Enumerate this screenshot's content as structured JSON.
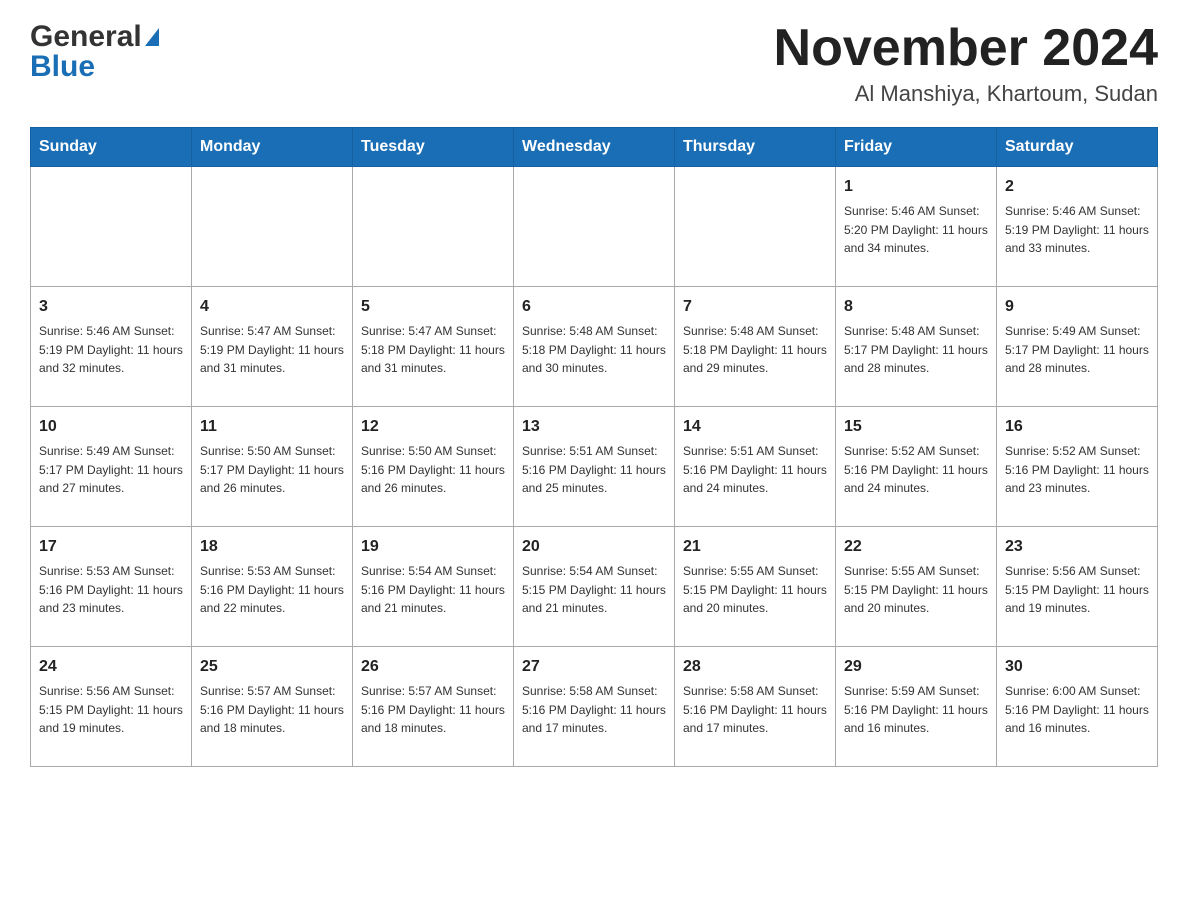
{
  "logo": {
    "general": "General",
    "blue": "Blue",
    "arrow": "▶"
  },
  "title": "November 2024",
  "location": "Al Manshiya, Khartoum, Sudan",
  "days_of_week": [
    "Sunday",
    "Monday",
    "Tuesday",
    "Wednesday",
    "Thursday",
    "Friday",
    "Saturday"
  ],
  "weeks": [
    {
      "cells": [
        {
          "day": "",
          "info": ""
        },
        {
          "day": "",
          "info": ""
        },
        {
          "day": "",
          "info": ""
        },
        {
          "day": "",
          "info": ""
        },
        {
          "day": "",
          "info": ""
        },
        {
          "day": "1",
          "info": "Sunrise: 5:46 AM\nSunset: 5:20 PM\nDaylight: 11 hours and 34 minutes."
        },
        {
          "day": "2",
          "info": "Sunrise: 5:46 AM\nSunset: 5:19 PM\nDaylight: 11 hours and 33 minutes."
        }
      ]
    },
    {
      "cells": [
        {
          "day": "3",
          "info": "Sunrise: 5:46 AM\nSunset: 5:19 PM\nDaylight: 11 hours and 32 minutes."
        },
        {
          "day": "4",
          "info": "Sunrise: 5:47 AM\nSunset: 5:19 PM\nDaylight: 11 hours and 31 minutes."
        },
        {
          "day": "5",
          "info": "Sunrise: 5:47 AM\nSunset: 5:18 PM\nDaylight: 11 hours and 31 minutes."
        },
        {
          "day": "6",
          "info": "Sunrise: 5:48 AM\nSunset: 5:18 PM\nDaylight: 11 hours and 30 minutes."
        },
        {
          "day": "7",
          "info": "Sunrise: 5:48 AM\nSunset: 5:18 PM\nDaylight: 11 hours and 29 minutes."
        },
        {
          "day": "8",
          "info": "Sunrise: 5:48 AM\nSunset: 5:17 PM\nDaylight: 11 hours and 28 minutes."
        },
        {
          "day": "9",
          "info": "Sunrise: 5:49 AM\nSunset: 5:17 PM\nDaylight: 11 hours and 28 minutes."
        }
      ]
    },
    {
      "cells": [
        {
          "day": "10",
          "info": "Sunrise: 5:49 AM\nSunset: 5:17 PM\nDaylight: 11 hours and 27 minutes."
        },
        {
          "day": "11",
          "info": "Sunrise: 5:50 AM\nSunset: 5:17 PM\nDaylight: 11 hours and 26 minutes."
        },
        {
          "day": "12",
          "info": "Sunrise: 5:50 AM\nSunset: 5:16 PM\nDaylight: 11 hours and 26 minutes."
        },
        {
          "day": "13",
          "info": "Sunrise: 5:51 AM\nSunset: 5:16 PM\nDaylight: 11 hours and 25 minutes."
        },
        {
          "day": "14",
          "info": "Sunrise: 5:51 AM\nSunset: 5:16 PM\nDaylight: 11 hours and 24 minutes."
        },
        {
          "day": "15",
          "info": "Sunrise: 5:52 AM\nSunset: 5:16 PM\nDaylight: 11 hours and 24 minutes."
        },
        {
          "day": "16",
          "info": "Sunrise: 5:52 AM\nSunset: 5:16 PM\nDaylight: 11 hours and 23 minutes."
        }
      ]
    },
    {
      "cells": [
        {
          "day": "17",
          "info": "Sunrise: 5:53 AM\nSunset: 5:16 PM\nDaylight: 11 hours and 23 minutes."
        },
        {
          "day": "18",
          "info": "Sunrise: 5:53 AM\nSunset: 5:16 PM\nDaylight: 11 hours and 22 minutes."
        },
        {
          "day": "19",
          "info": "Sunrise: 5:54 AM\nSunset: 5:16 PM\nDaylight: 11 hours and 21 minutes."
        },
        {
          "day": "20",
          "info": "Sunrise: 5:54 AM\nSunset: 5:15 PM\nDaylight: 11 hours and 21 minutes."
        },
        {
          "day": "21",
          "info": "Sunrise: 5:55 AM\nSunset: 5:15 PM\nDaylight: 11 hours and 20 minutes."
        },
        {
          "day": "22",
          "info": "Sunrise: 5:55 AM\nSunset: 5:15 PM\nDaylight: 11 hours and 20 minutes."
        },
        {
          "day": "23",
          "info": "Sunrise: 5:56 AM\nSunset: 5:15 PM\nDaylight: 11 hours and 19 minutes."
        }
      ]
    },
    {
      "cells": [
        {
          "day": "24",
          "info": "Sunrise: 5:56 AM\nSunset: 5:15 PM\nDaylight: 11 hours and 19 minutes."
        },
        {
          "day": "25",
          "info": "Sunrise: 5:57 AM\nSunset: 5:16 PM\nDaylight: 11 hours and 18 minutes."
        },
        {
          "day": "26",
          "info": "Sunrise: 5:57 AM\nSunset: 5:16 PM\nDaylight: 11 hours and 18 minutes."
        },
        {
          "day": "27",
          "info": "Sunrise: 5:58 AM\nSunset: 5:16 PM\nDaylight: 11 hours and 17 minutes."
        },
        {
          "day": "28",
          "info": "Sunrise: 5:58 AM\nSunset: 5:16 PM\nDaylight: 11 hours and 17 minutes."
        },
        {
          "day": "29",
          "info": "Sunrise: 5:59 AM\nSunset: 5:16 PM\nDaylight: 11 hours and 16 minutes."
        },
        {
          "day": "30",
          "info": "Sunrise: 6:00 AM\nSunset: 5:16 PM\nDaylight: 11 hours and 16 minutes."
        }
      ]
    }
  ]
}
